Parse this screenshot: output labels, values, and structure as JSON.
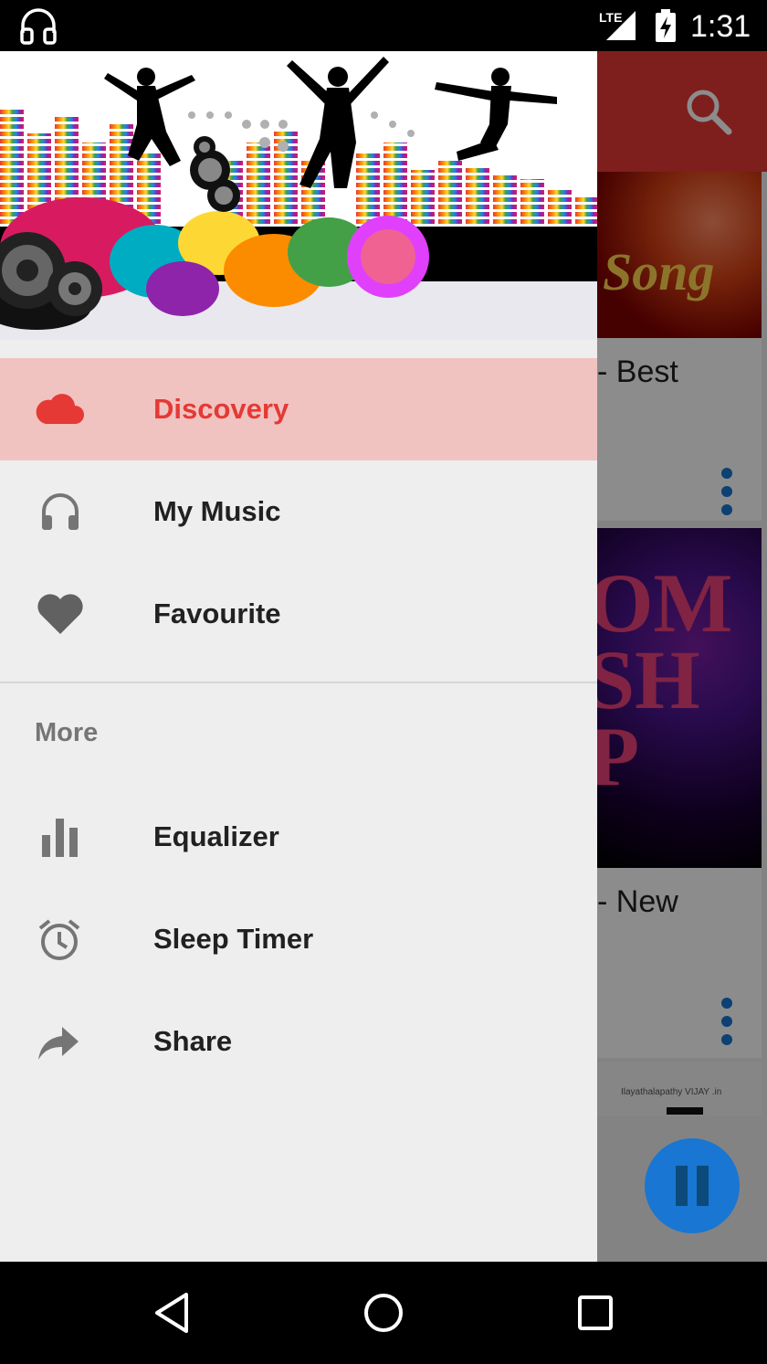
{
  "status_bar": {
    "time": "1:31",
    "network": "LTE",
    "icons": [
      "headset-icon",
      "lte-signal-icon",
      "battery-charging-icon"
    ]
  },
  "background_app": {
    "toolbar_color": "#e53935",
    "cards": [
      {
        "art_text": "Song",
        "title_fragment": "- Best"
      },
      {
        "art_text": "OM\nSH\nP",
        "title_fragment": "- New"
      },
      {
        "art_text": "Ilayathalapathy VIJAY .in"
      }
    ]
  },
  "drawer": {
    "items": [
      {
        "label": "Discovery",
        "icon": "cloud-icon",
        "active": true
      },
      {
        "label": "My Music",
        "icon": "headphones-icon",
        "active": false
      },
      {
        "label": "Favourite",
        "icon": "heart-icon",
        "active": false
      }
    ],
    "more_section": {
      "title": "More",
      "items": [
        {
          "label": "Equalizer",
          "icon": "equalizer-icon"
        },
        {
          "label": "Sleep Timer",
          "icon": "alarm-clock-icon"
        },
        {
          "label": "Share",
          "icon": "share-arrow-icon"
        }
      ]
    }
  },
  "colors": {
    "accent": "#e53935",
    "active_bg": "#f0c3c0",
    "fab": "#1976d2"
  }
}
